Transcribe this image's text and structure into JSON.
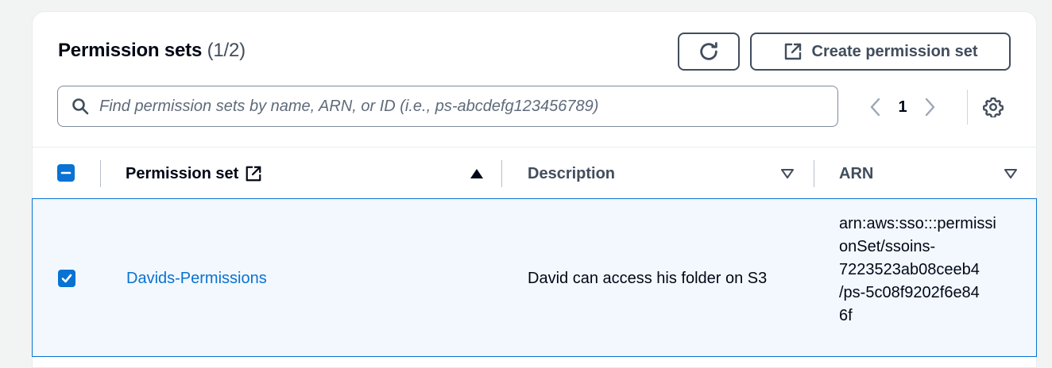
{
  "header": {
    "title": "Permission sets",
    "count": "(1/2)",
    "create_label": "Create permission set"
  },
  "search": {
    "placeholder": "Find permission sets by name, ARN, or ID (i.e., ps-abcdefg123456789)"
  },
  "pagination": {
    "current_page": "1"
  },
  "table": {
    "columns": [
      {
        "label": "Permission set",
        "sort": "ascending"
      },
      {
        "label": "Description",
        "sort": "none"
      },
      {
        "label": "ARN",
        "sort": "none"
      }
    ],
    "rows": [
      {
        "selected": true,
        "name": "Davids-Permissions",
        "description": "David can access his folder on S3",
        "arn_lines": [
          "arn:aws:sso:::permissi",
          "onSet/ssoins-",
          "7223523ab08ceeb4",
          "/ps-5c08f9202f6e84",
          "6f"
        ]
      }
    ]
  },
  "colors": {
    "accent": "#0972d3",
    "selected_row_bg": "#f2f8fd",
    "button_text": "#414d5c"
  },
  "icons": [
    "refresh-icon",
    "external-link-icon",
    "search-icon",
    "chevron-left-icon",
    "chevron-right-icon",
    "gear-icon",
    "sort-ascending-icon",
    "sort-descending-icon",
    "checkbox-indeterminate-icon",
    "checkbox-checked-icon"
  ]
}
